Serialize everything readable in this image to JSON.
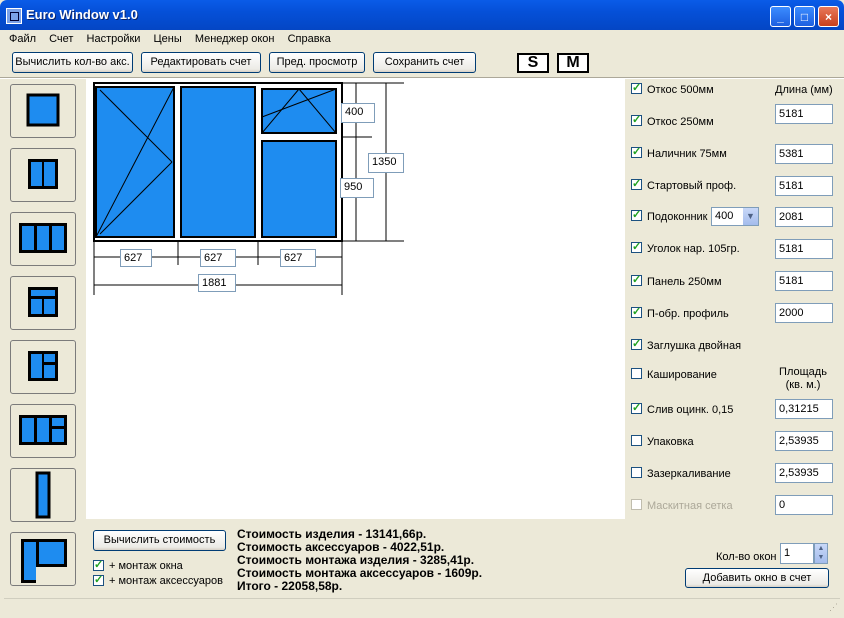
{
  "window": {
    "title": "Euro Window v1.0",
    "minimize": "_",
    "maximize": "□",
    "close": "×"
  },
  "menu": [
    "Файл",
    "Счет",
    "Настройки",
    "Цены",
    "Менеджер окон",
    "Справка"
  ],
  "toolbar": {
    "calc_accessories": "Вычислить кол-во акс.",
    "edit_invoice": "Редактировать счет",
    "preview": "Пред. просмотр",
    "save_invoice": "Сохранить счет",
    "s_label": "S",
    "m_label": "M"
  },
  "drawing": {
    "sash_widths": [
      "627",
      "627",
      "627"
    ],
    "total_width": "1881",
    "top_height": "400",
    "bottom_height": "950",
    "total_height": "1350"
  },
  "options": {
    "length_header": "Длина (мм)",
    "area_header": "Площадь (кв. м.)",
    "items": [
      {
        "label": "Откос 500мм",
        "checked": true,
        "value": ""
      },
      {
        "label": "Откос 250мм",
        "checked": true,
        "value": "5181"
      },
      {
        "label": "Наличник 75мм",
        "checked": true,
        "value": "5381"
      },
      {
        "label": "Стартовый проф.",
        "checked": true,
        "value": "5181"
      },
      {
        "label": "Подоконник",
        "checked": true,
        "value": "2081",
        "select": "400"
      },
      {
        "label": "Уголок нар. 105гр.",
        "checked": true,
        "value": "5181"
      },
      {
        "label": "Панель 250мм",
        "checked": true,
        "value": "5181"
      },
      {
        "label": "П-обр. профиль",
        "checked": true,
        "value": "2000"
      },
      {
        "label": "Заглушка двойная",
        "checked": true,
        "value": ""
      },
      {
        "label": "Каширование",
        "checked": false,
        "value": ""
      },
      {
        "label": "Слив оцинк. 0,15",
        "checked": true,
        "value": "0,31215"
      },
      {
        "label": "Упаковка",
        "checked": false,
        "value": "2,53935"
      },
      {
        "label": "Зазеркаливание",
        "checked": false,
        "value": "2,53935"
      },
      {
        "label": "Маскитная сетка",
        "checked": false,
        "disabled": true,
        "value": "0"
      }
    ]
  },
  "bottom": {
    "calc_cost": "Вычислить стоимость",
    "mount_window": "+ монтаж окна",
    "mount_accessories": "+ монтаж аксессуаров",
    "costs": [
      "Стоимость изделия - 13141,66р.",
      "Стоимость аксессуаров - 4022,51р.",
      "Стоимость монтажа изделия - 3285,41р.",
      "Стоимость монтажа аксессуаров - 1609р.",
      "Итого - 22058,58р."
    ],
    "window_count_label": "Кол-во окон",
    "window_count": "1",
    "add_window": "Добавить окно в счет"
  },
  "colors": {
    "glass": "#1e8cf0",
    "frame": "#000000",
    "titlebar": "#0550d8"
  }
}
